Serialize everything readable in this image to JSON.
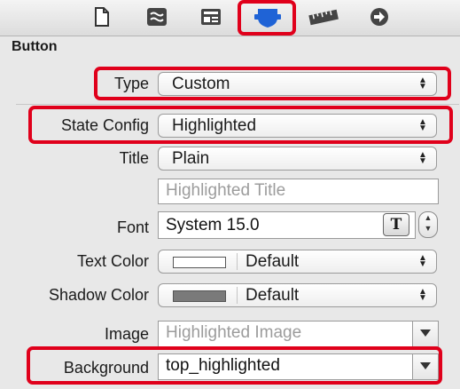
{
  "toolbar": {
    "tabs": [
      {
        "name": "file-inspector-icon"
      },
      {
        "name": "quick-help-icon"
      },
      {
        "name": "identity-inspector-icon"
      },
      {
        "name": "attributes-inspector-icon"
      },
      {
        "name": "size-inspector-icon"
      },
      {
        "name": "connections-inspector-icon"
      }
    ]
  },
  "panel": {
    "title": "Button",
    "type": {
      "label": "Type",
      "value": "Custom"
    },
    "state_config": {
      "label": "State Config",
      "value": "Highlighted"
    },
    "title_row": {
      "label": "Title",
      "value": "Plain",
      "placeholder": "Highlighted Title"
    },
    "font": {
      "label": "Font",
      "value": "System 15.0",
      "button_glyph": "T"
    },
    "text_color": {
      "label": "Text Color",
      "value": "Default",
      "swatch": "#ffffff"
    },
    "shadow_color": {
      "label": "Shadow Color",
      "value": "Default",
      "swatch": "#7a7a7a"
    },
    "image": {
      "label": "Image",
      "placeholder": "Highlighted Image"
    },
    "background": {
      "label": "Background",
      "value": "top_highlighted"
    }
  },
  "colors": {
    "highlight": "#e0001b",
    "accent": "#1f63d6"
  }
}
